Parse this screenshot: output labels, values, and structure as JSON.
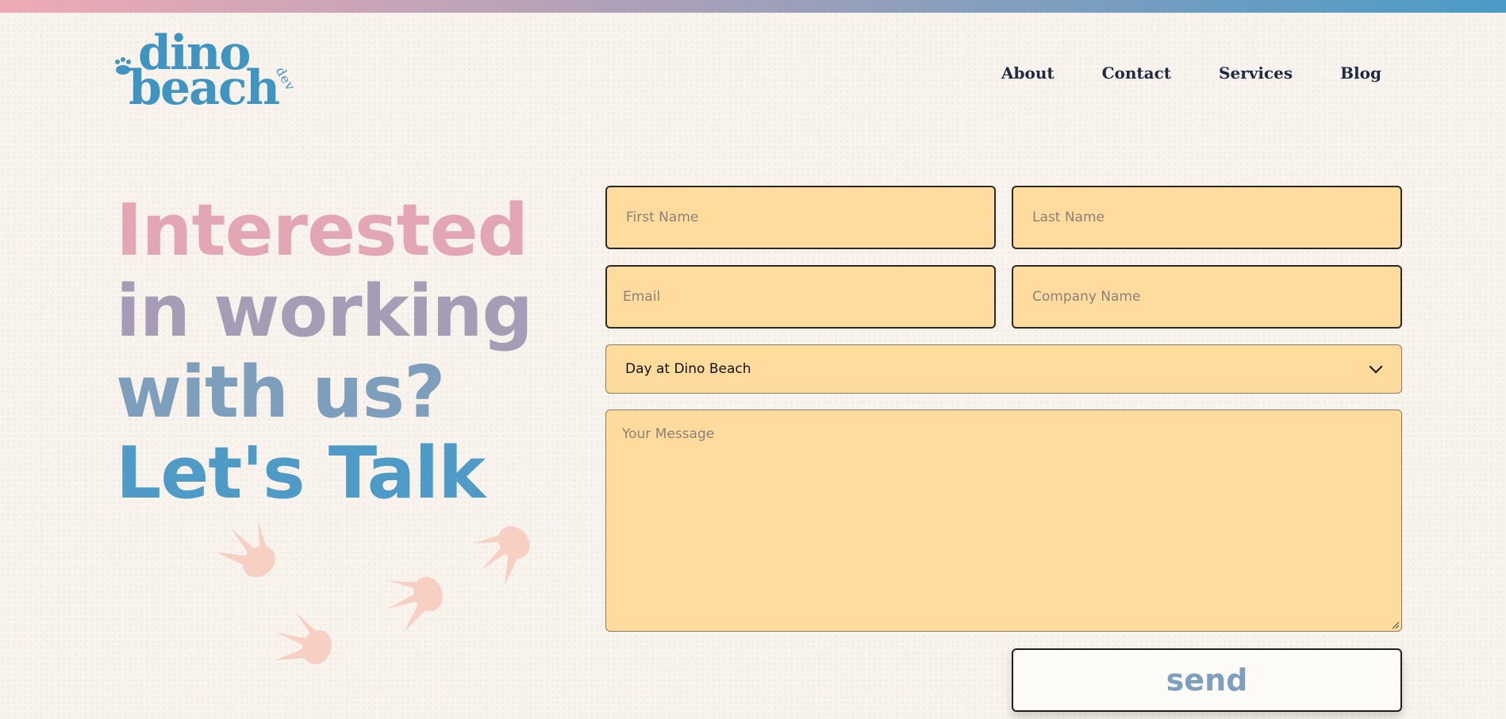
{
  "brand": {
    "line1": "dino",
    "line2": "beach",
    "suffix": "dev",
    "color": "#3f95c2"
  },
  "nav": {
    "items": [
      "About",
      "Contact",
      "Services",
      "Blog"
    ]
  },
  "headline": {
    "line1": "Interested",
    "line2": "in working",
    "line3": "with us?",
    "line4": "Let's Talk"
  },
  "form": {
    "first_name_placeholder": "First Name",
    "last_name_placeholder": "Last Name",
    "email_placeholder": "Email",
    "company_placeholder": "Company Name",
    "select_value": "Day at Dino Beach",
    "message_placeholder": "Your Message",
    "send_label": "send",
    "field_color": "#ffdc9e"
  },
  "colors": {
    "pink": "#e2a6b5",
    "blue": "#4d9bc6",
    "navy": "#1c2a44",
    "footprint": "#f7cfc3"
  }
}
